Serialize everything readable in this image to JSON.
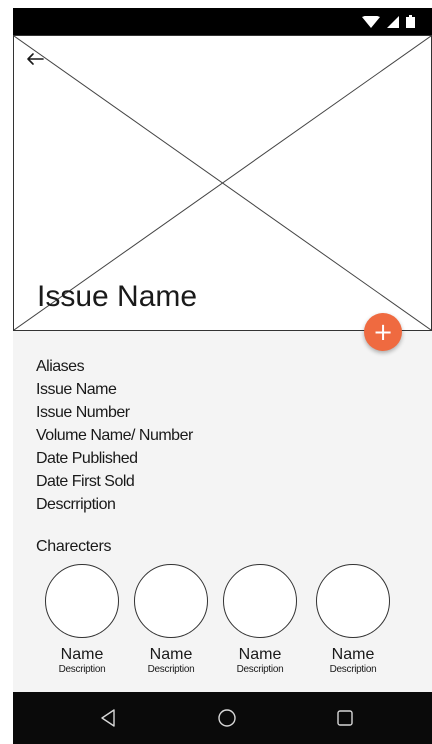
{
  "header": {
    "title": "Issue Name"
  },
  "fab": {
    "icon": "plus-icon",
    "symbol": "+"
  },
  "details": [
    "Aliases",
    "Issue Name",
    "Issue Number",
    "Volume Name/ Number",
    "Date Published",
    "Date First Sold",
    "Descrription"
  ],
  "characters": {
    "title": "Charecters",
    "items": [
      {
        "name": "Name",
        "description": "Description"
      },
      {
        "name": "Name",
        "description": "Description"
      },
      {
        "name": "Name",
        "description": "Description"
      },
      {
        "name": "Name",
        "description": "Description"
      }
    ]
  },
  "nav": {
    "back": "back-triangle-icon",
    "home": "home-circle-icon",
    "recents": "recents-square-icon"
  },
  "colors": {
    "fab": "#ef6a40",
    "system_bars": "#000000",
    "background": "#f4f4f4"
  }
}
